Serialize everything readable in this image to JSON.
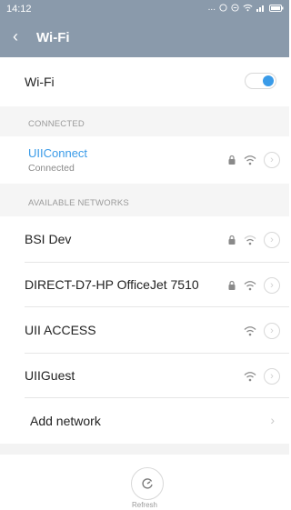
{
  "status": {
    "time": "14:12",
    "dots": "..."
  },
  "header": {
    "title": "Wi-Fi"
  },
  "wifi_toggle": {
    "label": "Wi-Fi",
    "enabled": true
  },
  "connected_section": {
    "title": "CONNECTED"
  },
  "connected_network": {
    "name": "UIIConnect",
    "status": "Connected",
    "secured": true
  },
  "available_section": {
    "title": "AVAILABLE NETWORKS"
  },
  "available_networks": [
    {
      "name": "BSI Dev",
      "secured": true
    },
    {
      "name": "DIRECT-D7-HP OfficeJet 7510",
      "secured": true
    },
    {
      "name": "UII ACCESS",
      "secured": false
    },
    {
      "name": "UIIGuest",
      "secured": false
    }
  ],
  "add_network": {
    "label": "Add network"
  },
  "refresh": {
    "label": "Refresh"
  },
  "colors": {
    "header": "#8a9aab",
    "accent": "#3a9be8"
  }
}
